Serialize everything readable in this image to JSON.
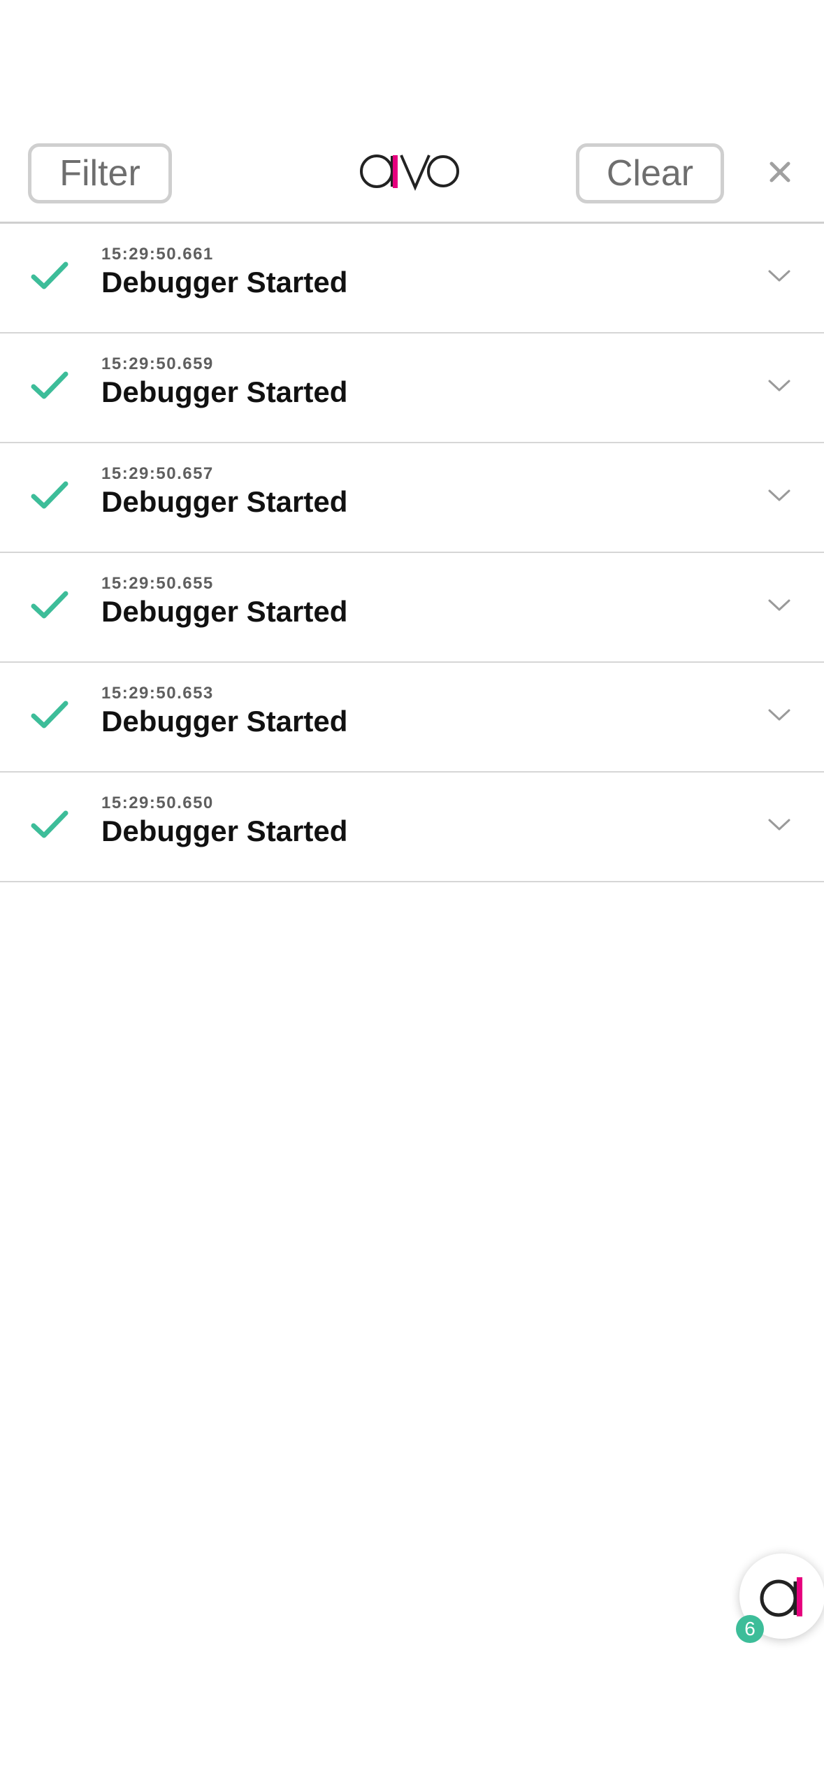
{
  "header": {
    "filter_label": "Filter",
    "clear_label": "Clear",
    "logo_text": "avo",
    "close_icon": "close-icon"
  },
  "events": [
    {
      "time": "15:29:50.661",
      "name": "Debugger Started",
      "status": "success"
    },
    {
      "time": "15:29:50.659",
      "name": "Debugger Started",
      "status": "success"
    },
    {
      "time": "15:29:50.657",
      "name": "Debugger Started",
      "status": "success"
    },
    {
      "time": "15:29:50.655",
      "name": "Debugger Started",
      "status": "success"
    },
    {
      "time": "15:29:50.653",
      "name": "Debugger Started",
      "status": "success"
    },
    {
      "time": "15:29:50.650",
      "name": "Debugger Started",
      "status": "success"
    }
  ],
  "fab": {
    "badge_count": "6"
  },
  "colors": {
    "accent_pink": "#e6007e",
    "success_green": "#3dbd99",
    "logo_dark": "#222222",
    "muted_gray": "#9a9a9a"
  }
}
